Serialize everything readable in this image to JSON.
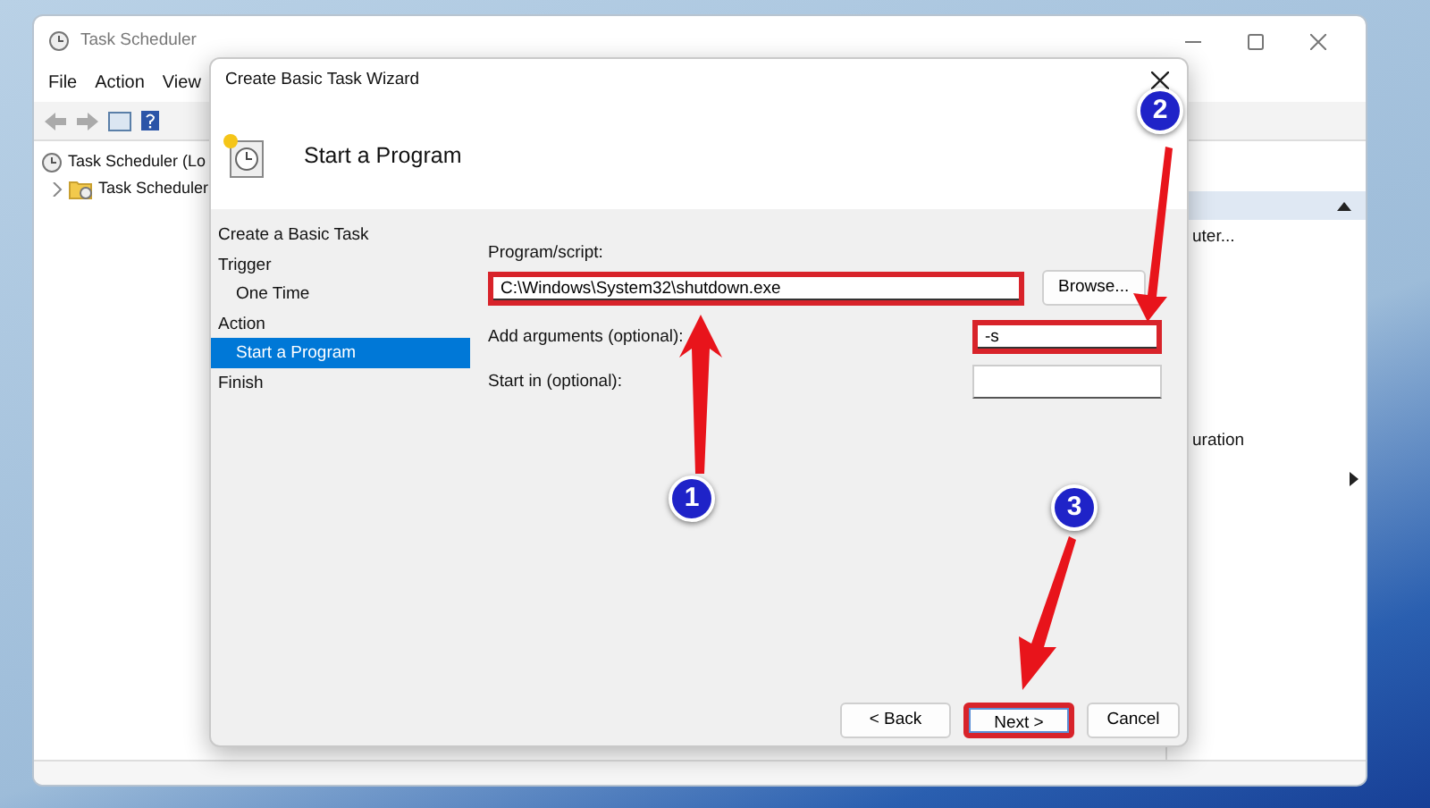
{
  "window": {
    "title": "Task Scheduler"
  },
  "menu": [
    "File",
    "Action",
    "View"
  ],
  "tree": [
    {
      "label": "Task Scheduler (Lo",
      "children": [
        {
          "label": "Task Scheduler",
          "expanded": false
        }
      ]
    }
  ],
  "actions_pane": {
    "items": [
      {
        "label": "uter...",
        "kind": "text"
      },
      {
        "label": "uration",
        "kind": "text"
      },
      {
        "kind": "submenu"
      }
    ]
  },
  "dialog": {
    "title": "Create Basic Task Wizard",
    "header": "Start a Program",
    "steps": [
      {
        "label": "Create a Basic Task",
        "selected": false
      },
      {
        "label": "Trigger",
        "selected": false,
        "children": [
          {
            "label": "One Time",
            "selected": false
          }
        ]
      },
      {
        "label": "Action",
        "selected": false,
        "children": [
          {
            "label": "Start a Program",
            "selected": true
          }
        ]
      },
      {
        "label": "Finish",
        "selected": false
      }
    ],
    "program": {
      "label": "Program/script:",
      "value": "C:\\Windows\\System32\\shutdown.exe",
      "highlighted": true
    },
    "browse_button": "Browse...",
    "fields": [
      {
        "label": "Add arguments (optional):",
        "value": "-s",
        "highlighted": true
      },
      {
        "label": "Start in (optional):",
        "highlighted": false
      }
    ],
    "buttons": [
      {
        "label": "< Back",
        "highlighted": false
      },
      {
        "label": "Next >",
        "highlighted": true
      },
      {
        "label": "Cancel",
        "highlighted": false
      }
    ]
  },
  "annotations": [
    {
      "label": "1"
    },
    {
      "label": "2"
    },
    {
      "label": "3"
    }
  ]
}
